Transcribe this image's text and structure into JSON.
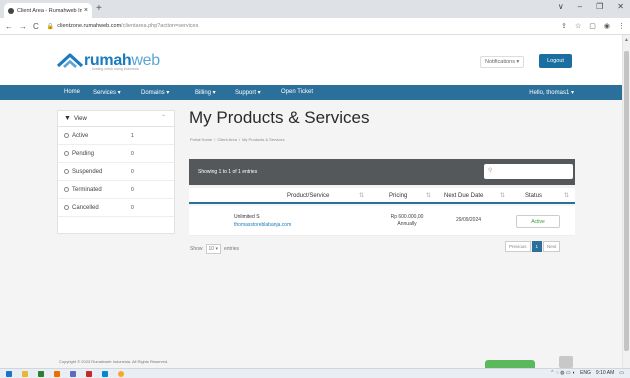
{
  "browser": {
    "tab_title": "Client Area - Rumahweb Indone",
    "tab_close": "×",
    "new_tab": "+",
    "url_host": "clientzone.rumahweb.com",
    "url_path": "/clientarea.php?action=services",
    "window_controls": [
      "∨",
      "–",
      "❐",
      "✕"
    ],
    "nav_icons": [
      "←",
      "→",
      "C"
    ]
  },
  "header": {
    "logo_main": "rumah",
    "logo_light": "web",
    "logo_sub": "hosting  untuk  orang  indonesia",
    "notifications": "Notifications",
    "logout": "Logout"
  },
  "nav": {
    "items": [
      "Home",
      "Services",
      "Domains",
      "Billing",
      "Support",
      "Open Ticket"
    ],
    "hello": "Hello, thomas1"
  },
  "sidebar": {
    "title": "View",
    "items": [
      {
        "label": "Active",
        "count": "1"
      },
      {
        "label": "Pending",
        "count": "0"
      },
      {
        "label": "Suspended",
        "count": "0"
      },
      {
        "label": "Terminated",
        "count": "0"
      },
      {
        "label": "Cancelled",
        "count": "0"
      }
    ]
  },
  "main": {
    "title": "My Products & Services",
    "breadcrumb": [
      "Portal Home",
      "Client Area",
      "My Products & Services"
    ],
    "showing": "Showing 1 to 1 of 1 entries",
    "columns": [
      "Product/Service",
      "Pricing",
      "Next Due Date",
      "Status"
    ],
    "rows": [
      {
        "product": "Unlimited S",
        "domain": "thomasstoreblabanja.com",
        "price": "Rp 600.000,00",
        "cycle": "Annually",
        "due": "29/09/2024",
        "status": "Active"
      }
    ],
    "show_label": "Show",
    "show_value": "10",
    "entries_label": "entries",
    "pager": {
      "prev": "Previous",
      "page": "1",
      "next": "Next"
    }
  },
  "footer": {
    "copyright": "Copyright © 2023 Rumahweb Indonesia. All Rights Reserved."
  },
  "taskbar": {
    "lang": "ENG",
    "time": "9:10 AM"
  },
  "colors": {
    "brand": "#2b6f9b",
    "logo": "#1a7bbf",
    "active": "#3a9a3a"
  }
}
